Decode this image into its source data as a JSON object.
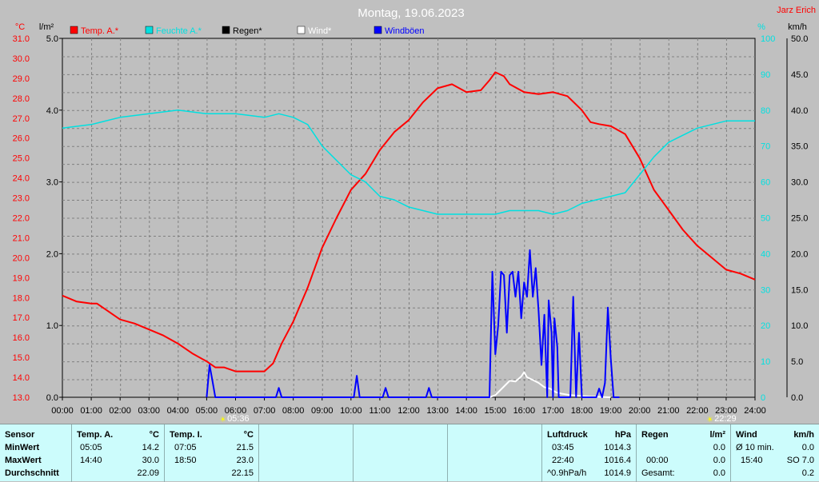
{
  "chart_data": {
    "type": "line",
    "title": "Montag, 19.06.2023",
    "author": "Jarz Erich",
    "left_units": [
      "°C",
      "l/m²"
    ],
    "right_units": [
      "%",
      "km/h"
    ],
    "x_ticks": [
      "00:00",
      "01:00",
      "02:00",
      "03:00",
      "04:00",
      "05:00",
      "06:00",
      "07:00",
      "08:00",
      "09:00",
      "10:00",
      "11:00",
      "12:00",
      "13:00",
      "14:00",
      "15:00",
      "16:00",
      "17:00",
      "18:00",
      "19:00",
      "20:00",
      "21:00",
      "22:00",
      "23:00",
      "24:00"
    ],
    "axes": {
      "temp": {
        "range": [
          13.0,
          31.0
        ],
        "ticks": [
          "13.0",
          "14.0",
          "15.0",
          "16.0",
          "17.0",
          "18.0",
          "19.0",
          "20.0",
          "21.0",
          "22.0",
          "23.0",
          "24.0",
          "25.0",
          "26.0",
          "27.0",
          "28.0",
          "29.0",
          "30.0",
          "31.0"
        ]
      },
      "rain": {
        "range": [
          0,
          5.0
        ],
        "ticks": [
          "0.0",
          "1.0",
          "2.0",
          "3.0",
          "4.0",
          "5.0"
        ]
      },
      "humidity": {
        "range": [
          0,
          100
        ],
        "ticks": [
          "0",
          "10",
          "20",
          "30",
          "40",
          "50",
          "60",
          "70",
          "80",
          "90",
          "100"
        ]
      },
      "wind": {
        "range": [
          0,
          50.0
        ],
        "ticks": [
          "0.0",
          "5.0",
          "10.0",
          "15.0",
          "20.0",
          "25.0",
          "30.0",
          "35.0",
          "40.0",
          "45.0",
          "50.0"
        ]
      }
    },
    "legend": [
      {
        "label": "Temp. A.*",
        "color": "#ff0000"
      },
      {
        "label": "Feuchte A.*",
        "color": "#00e0e0"
      },
      {
        "label": "Regen*",
        "color": "#000000"
      },
      {
        "label": "Wind*",
        "color": "#ffffff"
      },
      {
        "label": "Windböen",
        "color": "#0000ff"
      }
    ],
    "series": [
      {
        "name": "Temp. A.*",
        "axis": "temp",
        "color": "#ff0000",
        "points": [
          [
            0.0,
            18.1
          ],
          [
            0.5,
            17.8
          ],
          [
            1.0,
            17.7
          ],
          [
            1.2,
            17.7
          ],
          [
            1.5,
            17.4
          ],
          [
            2.0,
            16.9
          ],
          [
            2.5,
            16.7
          ],
          [
            3.0,
            16.4
          ],
          [
            3.5,
            16.1
          ],
          [
            4.0,
            15.7
          ],
          [
            4.5,
            15.2
          ],
          [
            5.0,
            14.8
          ],
          [
            5.3,
            14.5
          ],
          [
            5.6,
            14.5
          ],
          [
            6.0,
            14.3
          ],
          [
            6.5,
            14.3
          ],
          [
            7.0,
            14.3
          ],
          [
            7.3,
            14.7
          ],
          [
            7.6,
            15.7
          ],
          [
            8.0,
            16.8
          ],
          [
            8.5,
            18.5
          ],
          [
            9.0,
            20.5
          ],
          [
            9.5,
            22.0
          ],
          [
            10.0,
            23.4
          ],
          [
            10.5,
            24.2
          ],
          [
            11.0,
            25.4
          ],
          [
            11.5,
            26.3
          ],
          [
            12.0,
            26.9
          ],
          [
            12.5,
            27.8
          ],
          [
            13.0,
            28.5
          ],
          [
            13.5,
            28.7
          ],
          [
            14.0,
            28.3
          ],
          [
            14.5,
            28.4
          ],
          [
            14.8,
            28.9
          ],
          [
            15.0,
            29.3
          ],
          [
            15.3,
            29.1
          ],
          [
            15.5,
            28.7
          ],
          [
            16.0,
            28.3
          ],
          [
            16.5,
            28.2
          ],
          [
            17.0,
            28.3
          ],
          [
            17.5,
            28.1
          ],
          [
            18.0,
            27.4
          ],
          [
            18.3,
            26.8
          ],
          [
            18.6,
            26.7
          ],
          [
            19.0,
            26.6
          ],
          [
            19.5,
            26.2
          ],
          [
            20.0,
            25.0
          ],
          [
            20.5,
            23.4
          ],
          [
            21.0,
            22.4
          ],
          [
            21.5,
            21.4
          ],
          [
            22.0,
            20.6
          ],
          [
            22.5,
            20.0
          ],
          [
            23.0,
            19.4
          ],
          [
            23.5,
            19.2
          ],
          [
            24.0,
            18.9
          ]
        ]
      },
      {
        "name": "Feuchte A.*",
        "axis": "humidity",
        "color": "#00e0e0",
        "points": [
          [
            0.0,
            75
          ],
          [
            1.0,
            76
          ],
          [
            2.0,
            78
          ],
          [
            3.0,
            79
          ],
          [
            4.0,
            80
          ],
          [
            5.0,
            79
          ],
          [
            6.0,
            79
          ],
          [
            7.0,
            78
          ],
          [
            7.5,
            79
          ],
          [
            8.0,
            78
          ],
          [
            8.5,
            76
          ],
          [
            9.0,
            70
          ],
          [
            9.5,
            66
          ],
          [
            10.0,
            62
          ],
          [
            10.5,
            60
          ],
          [
            11.0,
            56
          ],
          [
            11.5,
            55
          ],
          [
            12.0,
            53
          ],
          [
            12.5,
            52
          ],
          [
            13.0,
            51
          ],
          [
            13.5,
            51
          ],
          [
            14.0,
            51
          ],
          [
            14.5,
            51
          ],
          [
            15.0,
            51
          ],
          [
            15.5,
            52
          ],
          [
            16.0,
            52
          ],
          [
            16.5,
            52
          ],
          [
            17.0,
            51
          ],
          [
            17.5,
            52
          ],
          [
            18.0,
            54
          ],
          [
            18.5,
            55
          ],
          [
            19.0,
            56
          ],
          [
            19.5,
            57
          ],
          [
            20.0,
            62
          ],
          [
            20.5,
            67
          ],
          [
            21.0,
            71
          ],
          [
            21.5,
            73
          ],
          [
            22.0,
            75
          ],
          [
            22.5,
            76
          ],
          [
            23.0,
            77
          ],
          [
            23.5,
            77
          ],
          [
            24.0,
            77
          ]
        ]
      },
      {
        "name": "Wind*",
        "axis": "wind",
        "color": "#ffffff",
        "points": [
          [
            14.8,
            0
          ],
          [
            15.0,
            0.3
          ],
          [
            15.3,
            1.5
          ],
          [
            15.5,
            2.3
          ],
          [
            15.7,
            2.2
          ],
          [
            15.9,
            2.9
          ],
          [
            16.0,
            3.5
          ],
          [
            16.1,
            2.8
          ],
          [
            16.3,
            2.4
          ],
          [
            16.5,
            2.0
          ],
          [
            16.7,
            1.4
          ],
          [
            16.9,
            1.2
          ],
          [
            17.1,
            0.7
          ],
          [
            17.3,
            0.5
          ],
          [
            17.6,
            0.3
          ],
          [
            17.9,
            0.2
          ],
          [
            18.3,
            0.1
          ],
          [
            19.0,
            0
          ]
        ]
      },
      {
        "name": "Windböen",
        "axis": "wind",
        "color": "#0000ff",
        "points": [
          [
            5.0,
            0
          ],
          [
            5.1,
            4.5
          ],
          [
            5.2,
            2.3
          ],
          [
            5.3,
            0
          ],
          [
            7.4,
            0
          ],
          [
            7.5,
            1.3
          ],
          [
            7.6,
            0
          ],
          [
            10.1,
            0
          ],
          [
            10.2,
            3.0
          ],
          [
            10.3,
            0
          ],
          [
            11.1,
            0
          ],
          [
            11.2,
            1.3
          ],
          [
            11.3,
            0
          ],
          [
            12.6,
            0
          ],
          [
            12.7,
            1.3
          ],
          [
            12.8,
            0
          ],
          [
            14.8,
            0
          ],
          [
            14.9,
            17.5
          ],
          [
            15.0,
            6.0
          ],
          [
            15.1,
            10.0
          ],
          [
            15.2,
            17.5
          ],
          [
            15.3,
            17.0
          ],
          [
            15.4,
            9.0
          ],
          [
            15.5,
            17.0
          ],
          [
            15.6,
            17.5
          ],
          [
            15.7,
            14.0
          ],
          [
            15.8,
            17.5
          ],
          [
            15.9,
            11.0
          ],
          [
            16.0,
            16.0
          ],
          [
            16.1,
            14.0
          ],
          [
            16.2,
            20.5
          ],
          [
            16.3,
            14.0
          ],
          [
            16.4,
            18.0
          ],
          [
            16.5,
            12.0
          ],
          [
            16.6,
            4.5
          ],
          [
            16.7,
            11.5
          ],
          [
            16.8,
            0
          ],
          [
            16.85,
            13.5
          ],
          [
            16.95,
            9.0
          ],
          [
            17.0,
            0
          ],
          [
            17.05,
            11.0
          ],
          [
            17.15,
            7.0
          ],
          [
            17.2,
            0
          ],
          [
            17.6,
            0
          ],
          [
            17.7,
            14.0
          ],
          [
            17.8,
            0
          ],
          [
            17.9,
            9.0
          ],
          [
            18.0,
            0
          ],
          [
            18.5,
            0
          ],
          [
            18.6,
            1.2
          ],
          [
            18.7,
            0
          ],
          [
            18.8,
            2.0
          ],
          [
            18.9,
            12.5
          ],
          [
            19.0,
            5.5
          ],
          [
            19.1,
            0
          ],
          [
            19.3,
            0
          ]
        ]
      }
    ],
    "markers": [
      {
        "label": "05:36",
        "x": 5.6,
        "icon": "sunrise-icon"
      },
      {
        "label": "22:29",
        "x": 22.48,
        "icon": "sunset-icon"
      }
    ]
  },
  "stats": {
    "sensor": {
      "header": "Sensor",
      "rows": [
        "MinWert",
        "MaxWert",
        "Durchschnitt"
      ]
    },
    "temp_a": {
      "header": "Temp. A.",
      "unit": "°C",
      "rows": [
        [
          "05:05",
          "14.2"
        ],
        [
          "14:40",
          "30.0"
        ],
        [
          "",
          "22.09"
        ]
      ]
    },
    "temp_i": {
      "header": "Temp. I.",
      "unit": "°C",
      "rows": [
        [
          "07:05",
          "21.5"
        ],
        [
          "18:50",
          "23.0"
        ],
        [
          "",
          "22.15"
        ]
      ]
    },
    "luftdruck": {
      "header": "Luftdruck",
      "unit": "hPa",
      "rows": [
        [
          "03:45",
          "1014.3"
        ],
        [
          "22:40",
          "1016.4"
        ],
        [
          "^0.9hPa/h",
          "1014.9"
        ]
      ]
    },
    "regen": {
      "header": "Regen",
      "unit": "l/m²",
      "rows": [
        [
          "",
          ""
        ],
        [
          "00:00",
          "0.0"
        ],
        [
          "Gesamt:",
          "0.0"
        ]
      ],
      "first_value": "0.0"
    },
    "wind": {
      "header": "Wind",
      "unit": "km/h",
      "rows": [
        [
          "Ø 10 min.",
          "0.0"
        ],
        [
          "15:40",
          "SO 7.0"
        ],
        [
          "",
          "0.2"
        ]
      ]
    }
  }
}
